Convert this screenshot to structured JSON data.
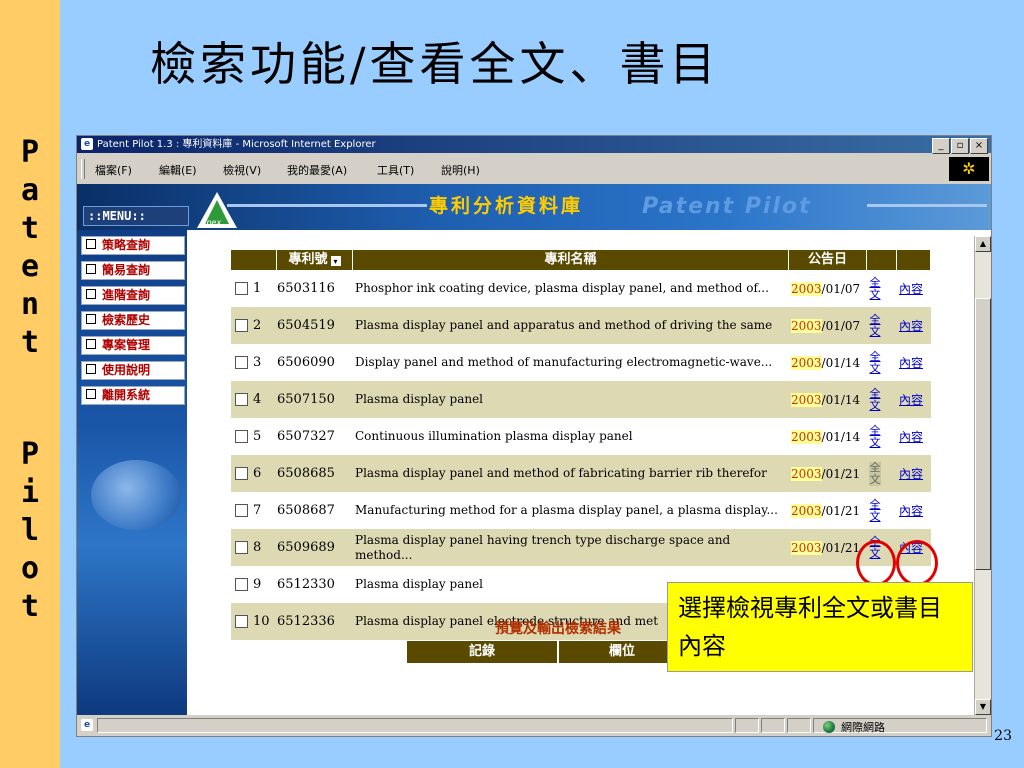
{
  "slide": {
    "title": "檢索功能/查看全文、書目",
    "side_text": [
      "P",
      "a",
      "t",
      "e",
      "n",
      "t",
      "P",
      "i",
      "l",
      "o",
      "t"
    ],
    "page_number": "23"
  },
  "window": {
    "title": "Patent Pilot 1.3 : 專利資料庫 - Microsoft Internet Explorer",
    "controls": [
      "_",
      "▫",
      "×"
    ]
  },
  "menu": {
    "items": [
      "檔案(F)",
      "編輯(E)",
      "檢視(V)",
      "我的最愛(A)",
      "工具(T)",
      "說明(H)"
    ]
  },
  "banner": {
    "menu_label": "::MENU::",
    "logo_text": "Apex",
    "title_cn": "專利分析資料庫",
    "title_en": "Patent Pilot"
  },
  "nav": {
    "items": [
      "策略查詢",
      "簡易查詢",
      "進階查詢",
      "檢索歷史",
      "專案管理",
      "使用說明",
      "離開系統"
    ]
  },
  "results": {
    "headers": [
      "專利號",
      "專利名稱",
      "公告日"
    ],
    "rows": [
      {
        "no": "1",
        "patent": "6503116",
        "title": "Phosphor ink coating device, plasma display panel, and method of...",
        "year": "2003",
        "date": "/01/07",
        "fulltext": "全文",
        "content": "內容"
      },
      {
        "no": "2",
        "patent": "6504519",
        "title": "Plasma display panel and apparatus and method of driving the same",
        "year": "2003",
        "date": "/01/07",
        "fulltext": "全文",
        "content": "內容"
      },
      {
        "no": "3",
        "patent": "6506090",
        "title": "Display panel and method of manufacturing electromagnetic-wave...",
        "year": "2003",
        "date": "/01/14",
        "fulltext": "全文",
        "content": "內容"
      },
      {
        "no": "4",
        "patent": "6507150",
        "title": "Plasma display panel",
        "year": "2003",
        "date": "/01/14",
        "fulltext": "全文",
        "content": "內容"
      },
      {
        "no": "5",
        "patent": "6507327",
        "title": "Continuous illumination plasma display panel",
        "year": "2003",
        "date": "/01/14",
        "fulltext": "全文",
        "content": "內容"
      },
      {
        "no": "6",
        "patent": "6508685",
        "title": "Plasma display panel and method of fabricating barrier rib therefor",
        "year": "2003",
        "date": "/01/21",
        "fulltext": "全文",
        "content": "內容"
      },
      {
        "no": "7",
        "patent": "6508687",
        "title": "Manufacturing method for a plasma display panel, a plasma display...",
        "year": "2003",
        "date": "/01/21",
        "fulltext": "全文",
        "content": "內容"
      },
      {
        "no": "8",
        "patent": "6509689",
        "title": "Plasma display panel having trench type discharge space and method...",
        "year": "2003",
        "date": "/01/21",
        "fulltext": "全文",
        "content": "內容"
      },
      {
        "no": "9",
        "patent": "6512330",
        "title": "Plasma display panel",
        "year": "",
        "date": "",
        "fulltext": "",
        "content": ""
      },
      {
        "no": "10",
        "patent": "6512336",
        "title": "Plasma display panel electrode structure and met",
        "year": "",
        "date": "",
        "fulltext": "",
        "content": ""
      }
    ]
  },
  "output": {
    "title": "預覽及輸出檢索結果",
    "headers": [
      "記錄",
      "欄位"
    ]
  },
  "status": {
    "zone": "網際網路"
  },
  "callout": {
    "text": "選擇檢視專利全文或書目內容"
  },
  "colors": {
    "slide_bg": "#99ccff",
    "side_strip": "#ffcc66",
    "header_bg": "#5a4a00",
    "row_alt": "#ddd9b3",
    "highlight_circle": "#e00000",
    "callout_bg": "#ffff00"
  }
}
